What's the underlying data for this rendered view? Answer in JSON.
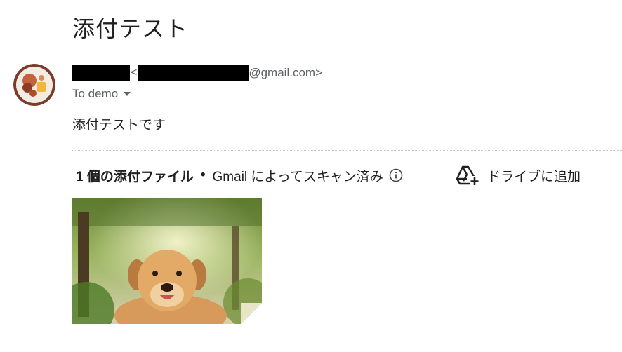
{
  "email": {
    "subject": "添付テスト",
    "sender_email_suffix": "@gmail.com>",
    "sender_lt": "<",
    "to_label": "To demo",
    "body": "添付テストです"
  },
  "attachments": {
    "count_label": "1 個の添付ファイル",
    "separator": "•",
    "scan_label": "Gmail によってスキャン済み",
    "drive_label": "ドライブに追加"
  },
  "icons": {
    "info": "info-icon",
    "drive": "add-to-drive-icon",
    "caret": "chevron-down-icon"
  },
  "colors": {
    "text": "#1f1f1f",
    "secondary": "#5f6368"
  }
}
